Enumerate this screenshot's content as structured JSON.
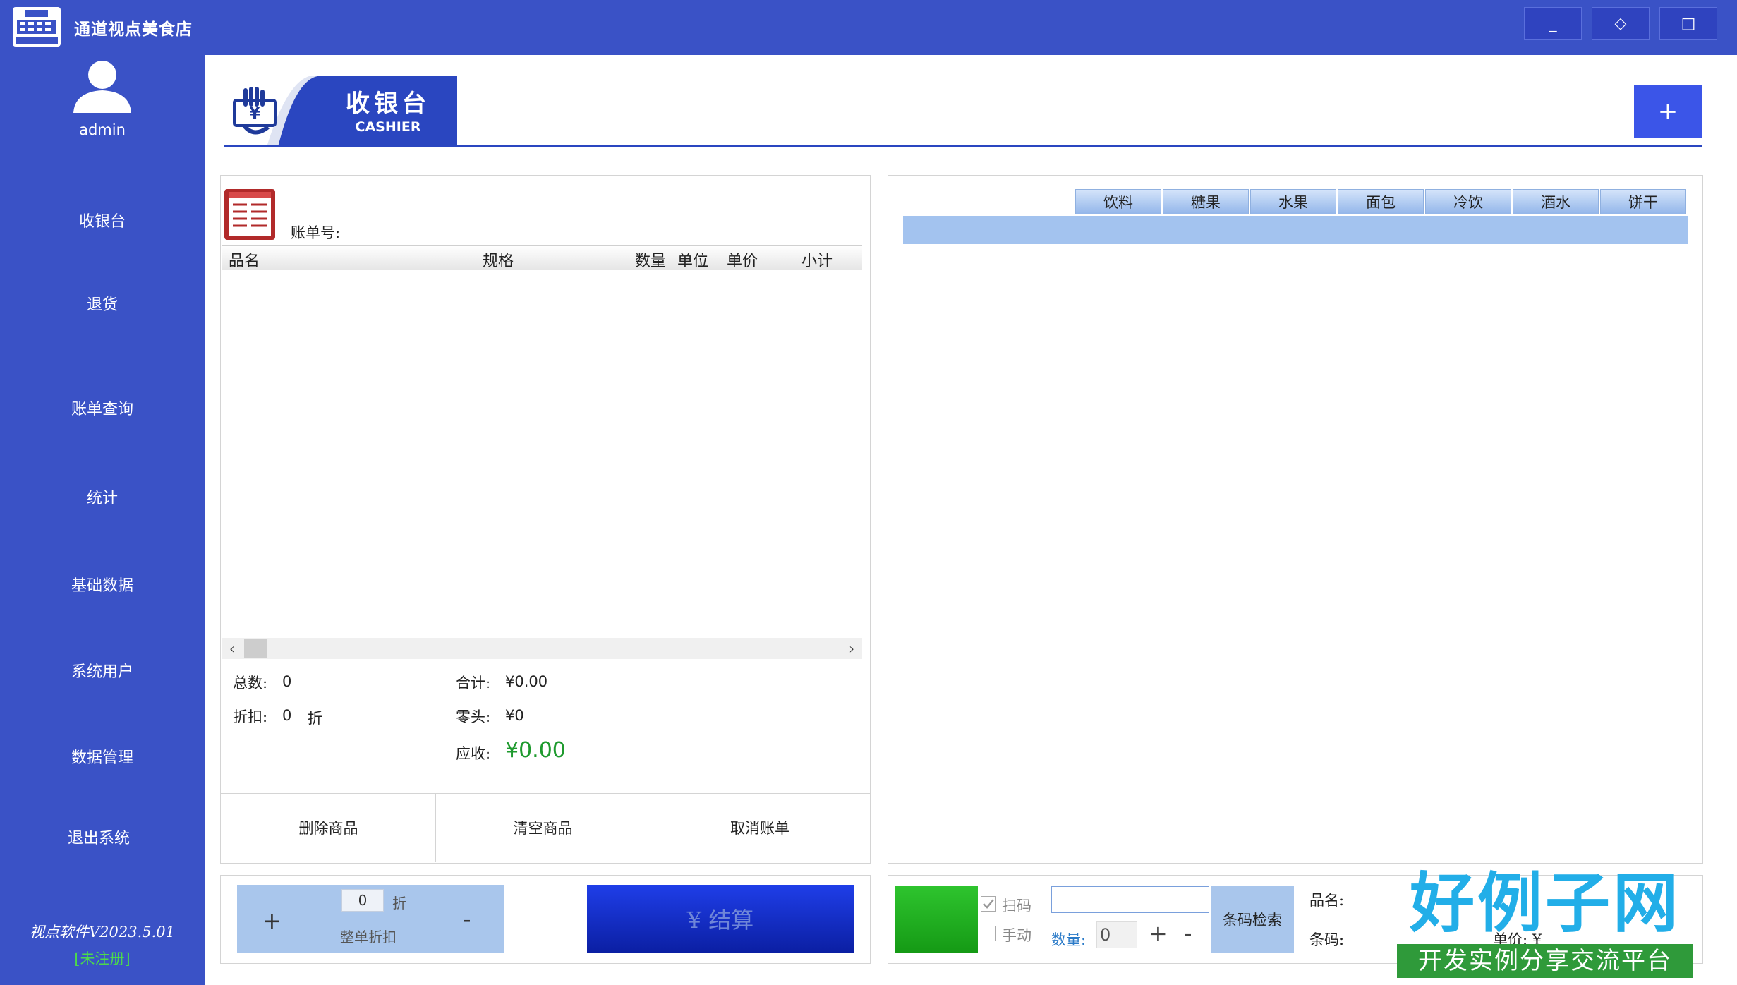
{
  "app": {
    "title": "通道视点美食店",
    "window_buttons": {
      "minimize": "_",
      "restore": "◇",
      "maximize": "□"
    }
  },
  "sidebar": {
    "user": "admin",
    "items": [
      {
        "label": "收银台"
      },
      {
        "label": "退货"
      },
      {
        "label": "账单查询"
      },
      {
        "label": "统计"
      },
      {
        "label": "基础数据"
      },
      {
        "label": "系统用户"
      },
      {
        "label": "数据管理"
      },
      {
        "label": "退出系统"
      }
    ],
    "version": "视点软件V2023.5.01",
    "registration": "[未注册]"
  },
  "header": {
    "banner_title": "收银台",
    "banner_subtitle": "CASHIER",
    "add_button": "+"
  },
  "bill": {
    "bill_no_label": "账单号:",
    "columns": [
      "品名",
      "规格",
      "数量",
      "单位",
      "单价",
      "小计"
    ],
    "rows": [],
    "scroll_left": "‹",
    "scroll_right": "›"
  },
  "summary": {
    "total_count_label": "总数:",
    "total_count": "0",
    "discount_label": "折扣:",
    "discount": "0",
    "discount_unit": "折",
    "sum_label": "合计:",
    "sum": "¥0.00",
    "rounding_label": "零头:",
    "rounding": "¥0",
    "due_label": "应收:",
    "due": "¥0.00"
  },
  "actions": {
    "delete": "删除商品",
    "clear": "清空商品",
    "cancel": "取消账单"
  },
  "discount_panel": {
    "plus": "+",
    "minus": "-",
    "value": "0",
    "unit": "折",
    "label": "整单折扣"
  },
  "checkout": {
    "label": "¥ 结算"
  },
  "categories": [
    "饮料",
    "糖果",
    "水果",
    "面包",
    "冷饮",
    "酒水",
    "饼干"
  ],
  "scan_panel": {
    "scan_label": "扫码",
    "scan_checked": true,
    "manual_label": "手动",
    "manual_checked": false,
    "barcode_value": "",
    "qty_label": "数量:",
    "qty_value": "0",
    "qty_plus": "+",
    "qty_minus": "-",
    "search_button": "条码检索",
    "name_label": "品名:",
    "barcode_label": "条码:",
    "unit_price_label": "单价: ¥"
  },
  "watermark": {
    "brand_big": "好例子网",
    "brand_small": "开发实例分享交流平台"
  },
  "colors": {
    "primary": "#3a52c6",
    "category_tab": "#a3c3ef",
    "due_green": "#1e9a2e",
    "checkout_blue": "#1f3ee8",
    "scan_green": "#2ec42e"
  }
}
